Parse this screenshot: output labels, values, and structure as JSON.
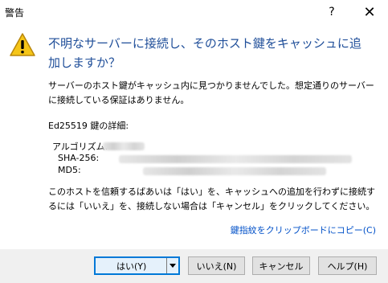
{
  "window": {
    "title": "警告",
    "help_glyph": "?",
    "close_glyph": "✕"
  },
  "message": {
    "main_instruction": "不明なサーバーに接続し、そのホスト鍵をキャッシュに追加しますか？",
    "detail_1": "サーバーのホスト鍵がキャッシュ内に見つかりませんでした。想定通りのサーバーに接続している保証はありません。",
    "fingerprint_heading": "Ed25519 鍵の詳細:",
    "algorithm_label": "アルゴリズム:",
    "sha256_label": "SHA-256:",
    "md5_label": "MD5:",
    "detail_2": "このホストを信頼するばあいは「はい」を、キャッシュへの追加を行わずに接続するには「いいえ」を、接続しない場合は「キャンセル」をクリックしてください。",
    "copy_link": "鍵指紋をクリップボードにコピー(C)"
  },
  "buttons": {
    "yes": "はい(Y)",
    "no": "いいえ(N)",
    "cancel": "キャンセル",
    "help": "ヘルプ(H)"
  },
  "colors": {
    "instruction": "#1f4e99",
    "link": "#0050c8",
    "accent": "#0078d7",
    "warning_fill": "#f5c518"
  },
  "icons": {
    "warning": "warning-icon",
    "dropdown": "chevron-down-icon"
  }
}
